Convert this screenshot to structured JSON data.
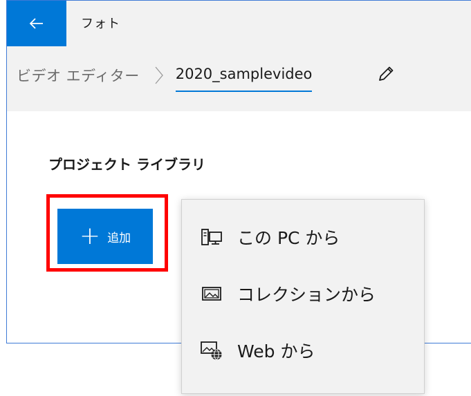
{
  "app": {
    "title": "フォト"
  },
  "breadcrumb": {
    "root": "ビデオ エディター",
    "current": "2020_samplevideo"
  },
  "library": {
    "title": "プロジェクト ライブラリ",
    "add_button": {
      "plus": "+",
      "label": "追加"
    }
  },
  "add_menu": {
    "items": [
      {
        "label": "この PC から",
        "icon": "pc-icon"
      },
      {
        "label": "コレクションから",
        "icon": "collection-icon"
      },
      {
        "label": "Web から",
        "icon": "web-icon"
      }
    ]
  },
  "colors": {
    "accent": "#0078d7",
    "highlight": "#ff0000",
    "surface": "#f2f2f2"
  }
}
